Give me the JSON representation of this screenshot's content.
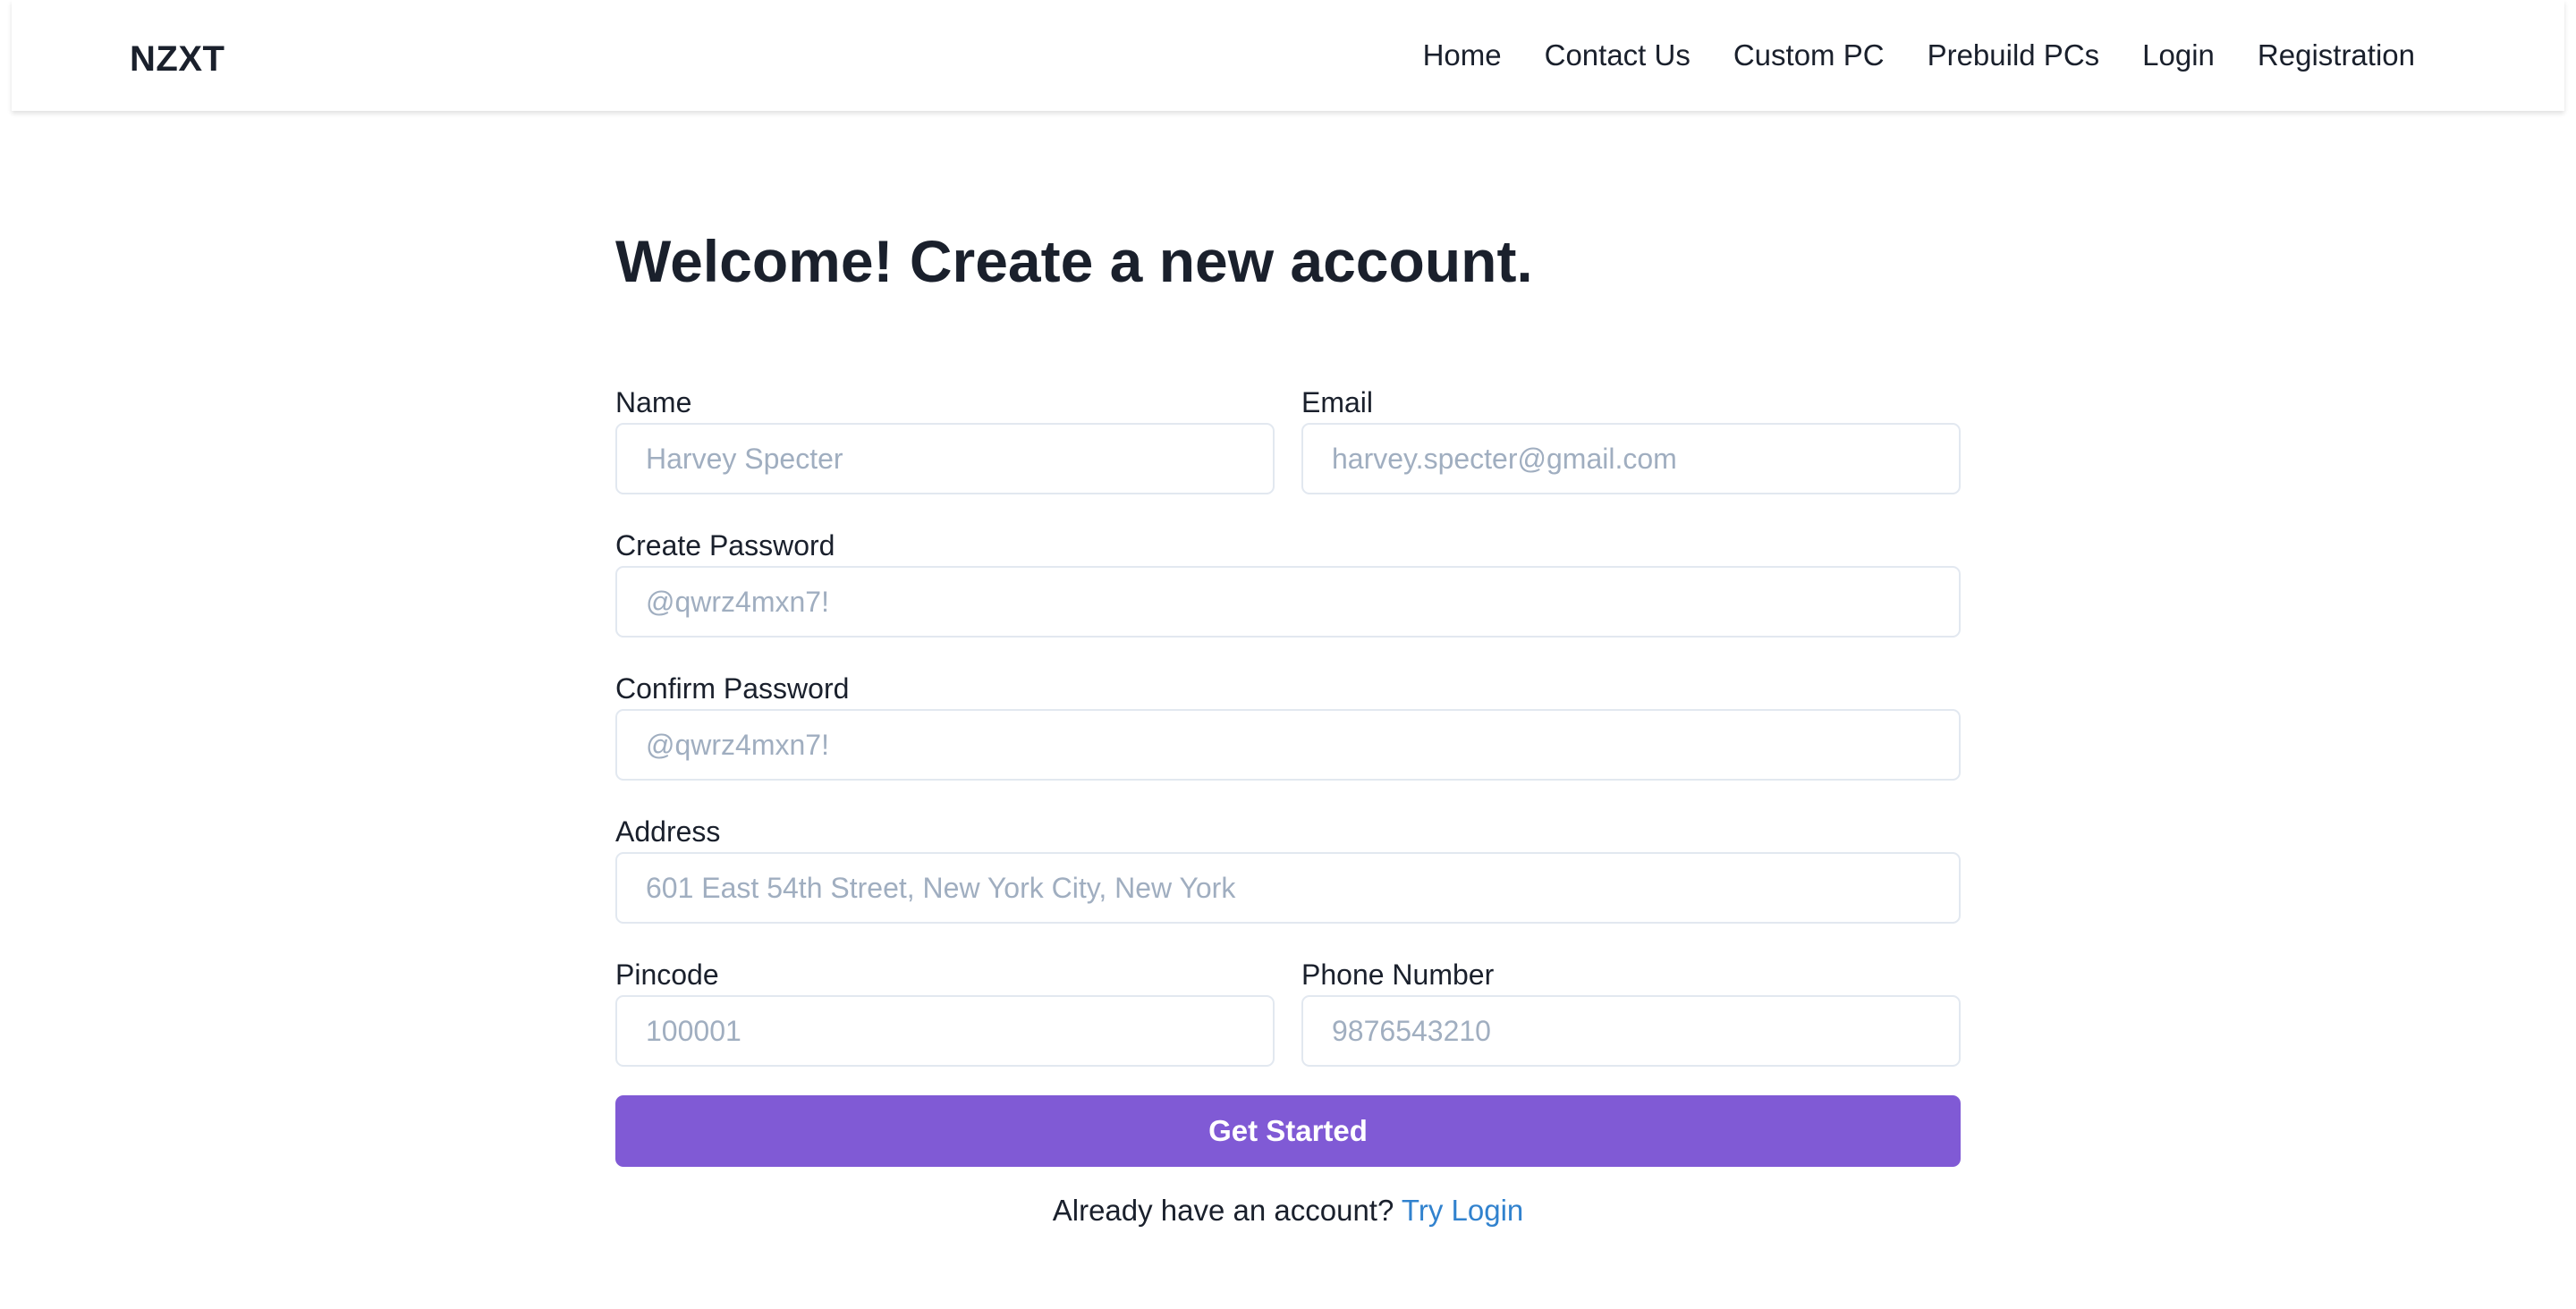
{
  "navbar": {
    "brand": "NZXT",
    "links": [
      "Home",
      "Contact Us",
      "Custom PC",
      "Prebuild PCs",
      "Login",
      "Registration"
    ]
  },
  "form": {
    "title": "Welcome! Create a new account.",
    "fields": {
      "name": {
        "label": "Name",
        "placeholder": "Harvey Specter"
      },
      "email": {
        "label": "Email",
        "placeholder": "harvey.specter@gmail.com"
      },
      "create_password": {
        "label": "Create Password",
        "placeholder": "@qwrz4mxn7!"
      },
      "confirm_password": {
        "label": "Confirm Password",
        "placeholder": "@qwrz4mxn7!"
      },
      "address": {
        "label": "Address",
        "placeholder": "601 East 54th Street, New York City, New York"
      },
      "pincode": {
        "label": "Pincode",
        "placeholder": "100001"
      },
      "phone": {
        "label": "Phone Number",
        "placeholder": "9876543210"
      }
    },
    "submit_label": "Get Started",
    "login_prompt": "Already have an account?",
    "login_link": "Try Login"
  },
  "colors": {
    "accent": "#805ad5",
    "link": "#3182ce",
    "text": "#1a202c",
    "placeholder": "#a0aec0",
    "border": "#e2e8f0"
  }
}
